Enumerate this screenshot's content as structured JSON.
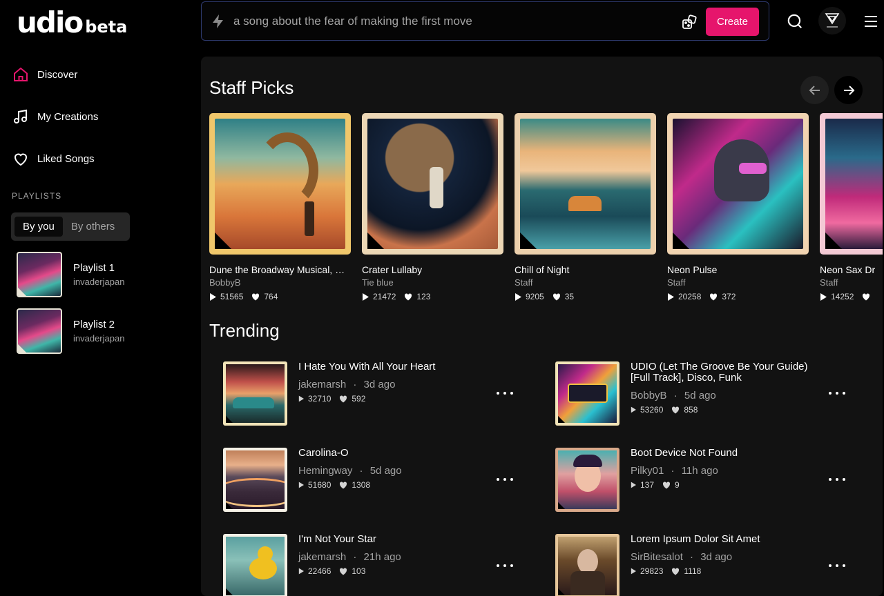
{
  "brand": {
    "logo": "udio",
    "tag": "beta"
  },
  "sidebar": {
    "nav": [
      {
        "label": "Discover",
        "icon": "home-icon",
        "active": true
      },
      {
        "label": "My Creations",
        "icon": "music-note-icon"
      },
      {
        "label": "Liked Songs",
        "icon": "heart-icon"
      }
    ],
    "playlists_title": "PLAYLISTS",
    "tabs": [
      "By you",
      "By others"
    ],
    "playlists": [
      {
        "name": "Playlist 1",
        "owner": "invaderjapan"
      },
      {
        "name": "Playlist 2",
        "owner": "invaderjapan"
      }
    ]
  },
  "topbar": {
    "search_placeholder": "a song about the fear of making the first move",
    "create_label": "Create"
  },
  "staff_picks": {
    "title": "Staff Picks",
    "cards": [
      {
        "title": "Dune the Broadway Musical, Sh...",
        "artist": "BobbyB",
        "plays": "51565",
        "likes": "764"
      },
      {
        "title": "Crater Lullaby",
        "artist": "Tie blue",
        "plays": "21472",
        "likes": "123"
      },
      {
        "title": "Chill of Night",
        "artist": "Staff",
        "plays": "9205",
        "likes": "35"
      },
      {
        "title": "Neon Pulse",
        "artist": "Staff",
        "plays": "20258",
        "likes": "372"
      },
      {
        "title": "Neon Sax Dr",
        "artist": "Staff",
        "plays": "14252",
        "likes": ""
      }
    ]
  },
  "trending": {
    "title": "Trending",
    "items": [
      {
        "title": "I Hate You With All Your Heart",
        "artist": "jakemarsh",
        "age": "3d ago",
        "plays": "32710",
        "likes": "592"
      },
      {
        "title": "UDIO (Let The Groove Be Your Guide) [Full Track], Disco, Funk",
        "artist": "BobbyB",
        "age": "5d ago",
        "plays": "53260",
        "likes": "858"
      },
      {
        "title": "Carolina-O",
        "artist": "Hemingway",
        "age": "5d ago",
        "plays": "51680",
        "likes": "1308"
      },
      {
        "title": "Boot Device Not Found",
        "artist": "Pilky01",
        "age": "11h ago",
        "plays": "137",
        "likes": "9"
      },
      {
        "title": "I'm Not Your Star",
        "artist": "jakemarsh",
        "age": "21h ago",
        "plays": "22466",
        "likes": "103"
      },
      {
        "title": "Lorem Ipsum Dolor Sit Amet",
        "artist": "SirBitesalot",
        "age": "3d ago",
        "plays": "29823",
        "likes": "1118"
      }
    ]
  },
  "colors": {
    "accent": "#e6156c",
    "panel": "#121212",
    "muted": "#a3a3a3"
  }
}
